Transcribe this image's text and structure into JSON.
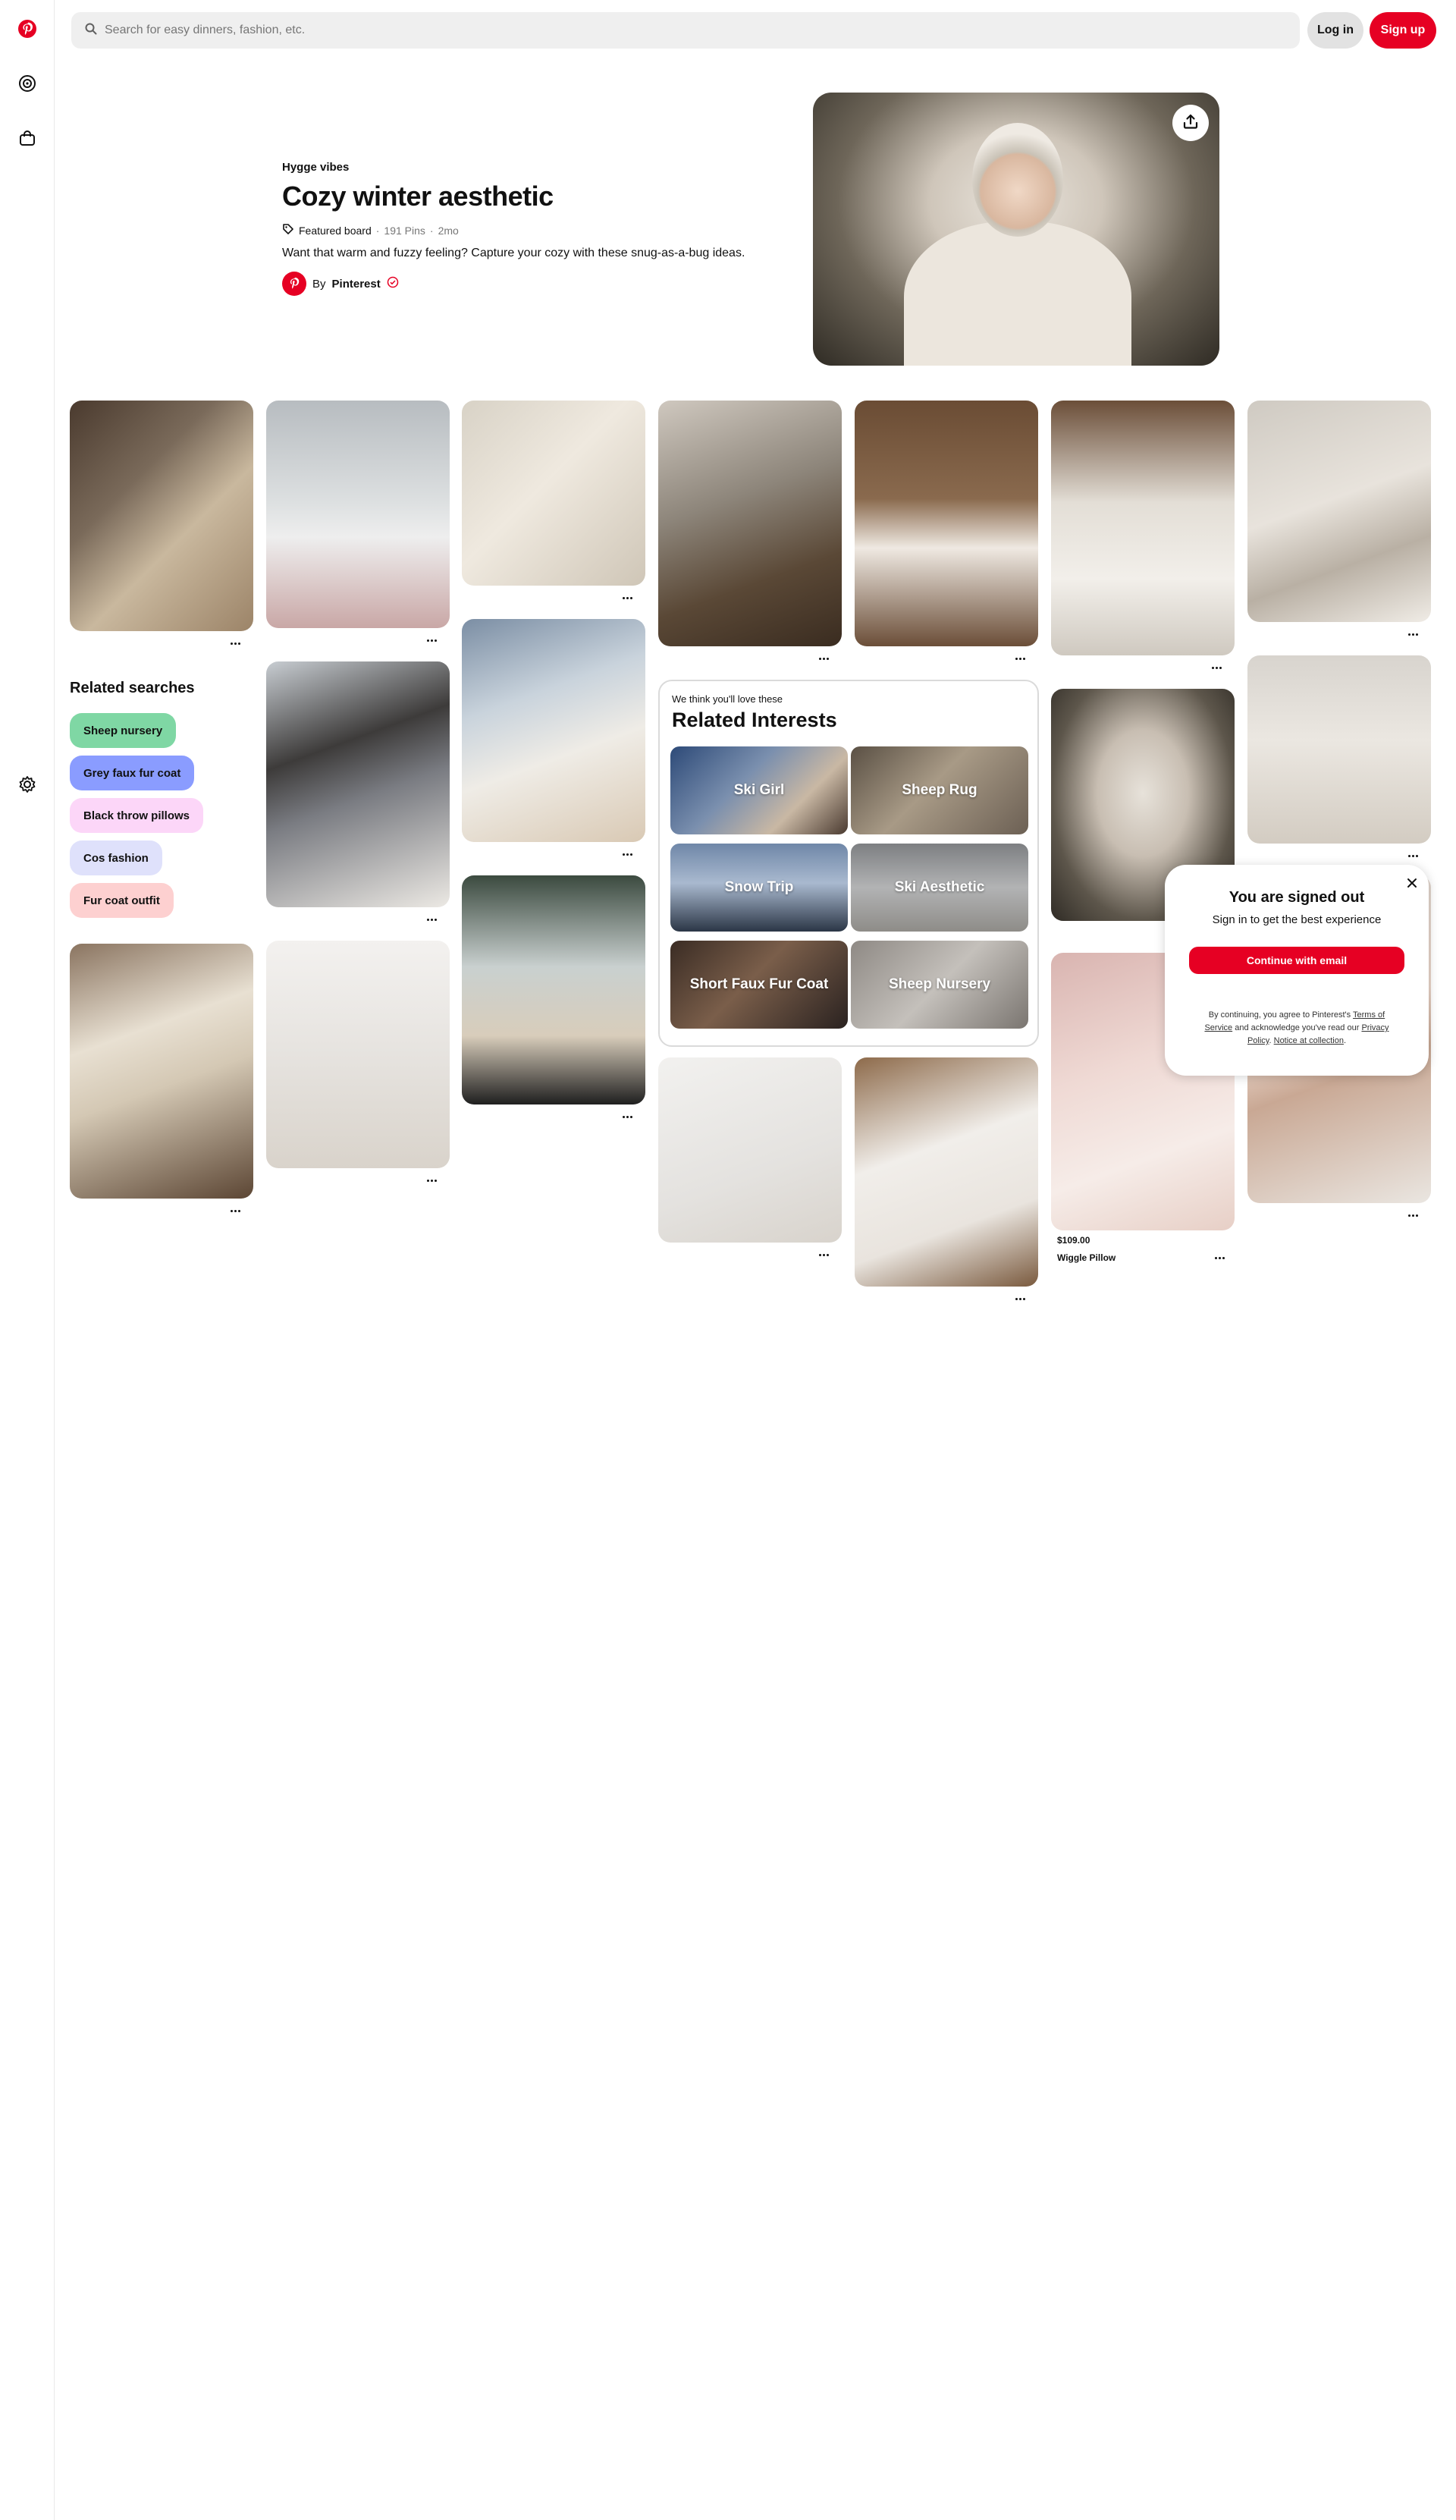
{
  "colors": {
    "brand": "#e60023",
    "chip_1": "#7fd7a4",
    "chip_2": "#8a9cff",
    "chip_3": "#fcd6f8",
    "chip_4": "#dfe1fb",
    "chip_5": "#fdd0d0"
  },
  "nav": {
    "icons": [
      "pinterest-logo-icon",
      "explore-icon",
      "shop-icon",
      "settings-icon"
    ]
  },
  "search": {
    "placeholder": "Search for easy dinners, fashion, etc."
  },
  "header": {
    "login_label": "Log in",
    "signup_label": "Sign up"
  },
  "board": {
    "kicker": "Hygge vibes",
    "title": "Cozy winter aesthetic",
    "featured_label": "Featured board",
    "pin_count": "191 Pins",
    "age": "2mo",
    "separator": "·",
    "description": "Want that warm and fuzzy feeling? Capture your cozy with these snug-as-a-bug ideas.",
    "by_label": "By",
    "owner_name": "Pinterest"
  },
  "related_searches": {
    "title": "Related searches",
    "items": [
      "Sheep nursery",
      "Grey faux fur coat",
      "Black throw pillows",
      "Cos fashion",
      "Fur coat outfit"
    ]
  },
  "related_interests": {
    "subtitle": "We think you'll love these",
    "title": "Related Interests",
    "items": [
      "Ski Girl",
      "Sheep Rug",
      "Snow Trip",
      "Ski Aesthetic",
      "Short Faux Fur Coat",
      "Sheep Nursery"
    ]
  },
  "product_pin": {
    "price": "$109.00",
    "title": "Wiggle Pillow"
  },
  "popup": {
    "title": "You are signed out",
    "subtitle": "Sign in to get the best experience",
    "button_label": "Continue with email",
    "legal_1": "By continuing, you agree to Pinterest's",
    "terms_link": "Terms of Service",
    "legal_2": "and acknowledge you've read our",
    "privacy_link": "Privacy Policy",
    "legal_3": ".",
    "notice_link": "Notice at collection",
    "legal_4": "."
  }
}
